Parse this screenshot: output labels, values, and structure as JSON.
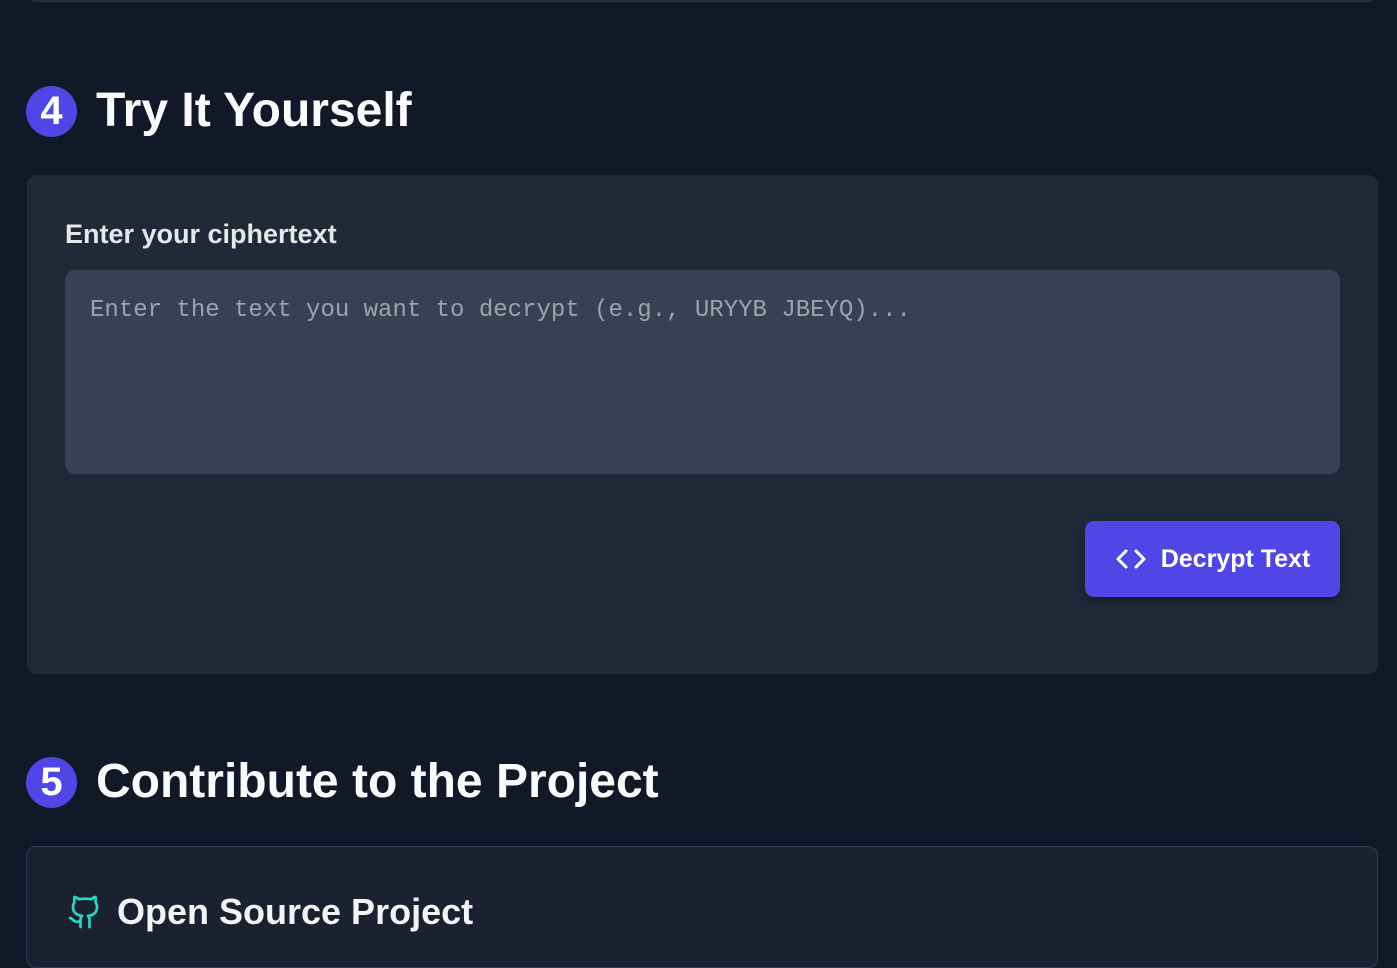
{
  "section4": {
    "number": "4",
    "title": "Try It Yourself",
    "input_label": "Enter your ciphertext",
    "input_value": "",
    "input_placeholder": "Enter the text you want to decrypt (e.g., URYYB JBEYQ)...",
    "button_label": "Decrypt Text",
    "button_icon": "code-icon"
  },
  "section5": {
    "number": "5",
    "title": "Contribute to the Project",
    "card_title": "Open Source Project",
    "card_icon": "github-icon"
  },
  "colors": {
    "page_background": "#111827",
    "card_background": "#1f2937",
    "input_background": "#374151",
    "accent": "#4f46e5",
    "github_icon": "#2dd4bf"
  }
}
